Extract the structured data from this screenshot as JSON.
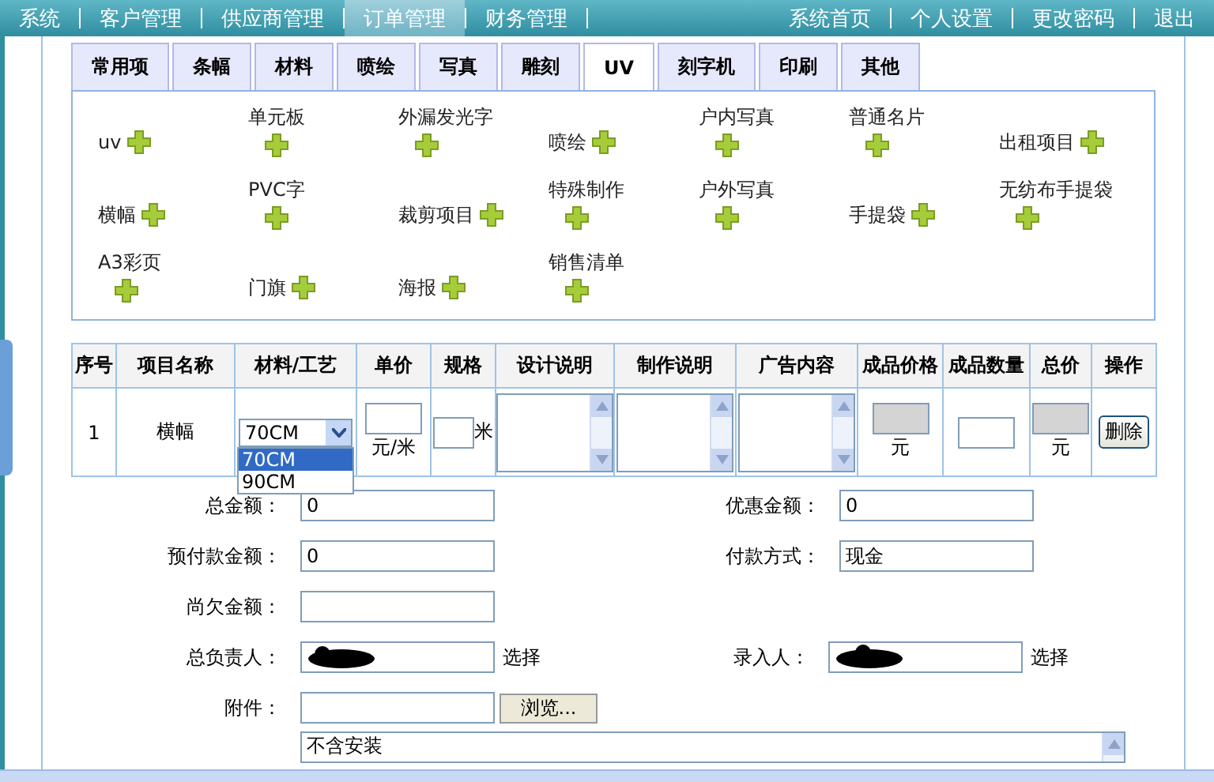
{
  "nav": {
    "left": [
      {
        "label": "系统",
        "selected": false
      },
      {
        "label": "客户管理",
        "selected": false
      },
      {
        "label": "供应商管理",
        "selected": false
      },
      {
        "label": "订单管理",
        "selected": true
      },
      {
        "label": "财务管理",
        "selected": false
      }
    ],
    "right": [
      "系统首页",
      "个人设置",
      "更改密码",
      "退出"
    ]
  },
  "tabs": [
    {
      "label": "常用项",
      "selected": false
    },
    {
      "label": "条幅",
      "selected": false
    },
    {
      "label": "材料",
      "selected": false
    },
    {
      "label": "喷绘",
      "selected": false
    },
    {
      "label": "写真",
      "selected": false
    },
    {
      "label": "雕刻",
      "selected": false
    },
    {
      "label": "UV",
      "selected": true
    },
    {
      "label": "刻字机",
      "selected": false
    },
    {
      "label": "印刷",
      "selected": false
    },
    {
      "label": "其他",
      "selected": false
    }
  ],
  "items": [
    {
      "label": "uv",
      "kind": "inline"
    },
    {
      "label": "单元板",
      "kind": "stacked"
    },
    {
      "label": "外漏发光字",
      "kind": "stacked"
    },
    {
      "label": "喷绘",
      "kind": "inline"
    },
    {
      "label": "户内写真",
      "kind": "stacked"
    },
    {
      "label": "普通名片",
      "kind": "stacked"
    },
    {
      "label": "出租项目",
      "kind": "inline"
    },
    {
      "label": "横幅",
      "kind": "inline"
    },
    {
      "label": "PVC字",
      "kind": "stacked"
    },
    {
      "label": "裁剪项目",
      "kind": "inline"
    },
    {
      "label": "特殊制作",
      "kind": "stacked"
    },
    {
      "label": "户外写真",
      "kind": "stacked"
    },
    {
      "label": "手提袋",
      "kind": "inline"
    },
    {
      "label": "无纺布手提袋",
      "kind": "stacked"
    },
    {
      "label": "A3彩页",
      "kind": "stacked"
    },
    {
      "label": "门旗",
      "kind": "inline"
    },
    {
      "label": "海报",
      "kind": "inline"
    },
    {
      "label": "销售清单",
      "kind": "stacked"
    }
  ],
  "table": {
    "columns": [
      "序号",
      "项目名称",
      "材料/工艺",
      "单价",
      "规格",
      "设计说明",
      "制作说明",
      "广告内容",
      "成品价格",
      "成品数量",
      "总价",
      "操作"
    ],
    "rows": [
      {
        "index": "1",
        "name": "横幅",
        "material": "70CM",
        "material_options": [
          {
            "label": "70CM",
            "selected": true
          },
          {
            "label": "90CM",
            "selected": false
          }
        ],
        "unit_price_unit": "元/米",
        "size_unit": "米",
        "product_price_unit": "元",
        "total_unit": "元",
        "delete": "删除"
      }
    ]
  },
  "form": [
    {
      "label": "总金额：",
      "value": "0",
      "label_2": "优惠金额：",
      "value_2": "0"
    },
    {
      "label": "预付款金额：",
      "value": "0",
      "label_2": "付款方式：",
      "value_2": "现金"
    },
    {
      "label": "尚欠金额："
    },
    {
      "label": "总负责人：",
      "redacted": true,
      "action": "选择",
      "label_2": "录入人：",
      "redacted_2": true,
      "action_2": "选择"
    },
    {
      "label": "附件：",
      "button": "浏览..."
    }
  ],
  "note": "不含安装"
}
